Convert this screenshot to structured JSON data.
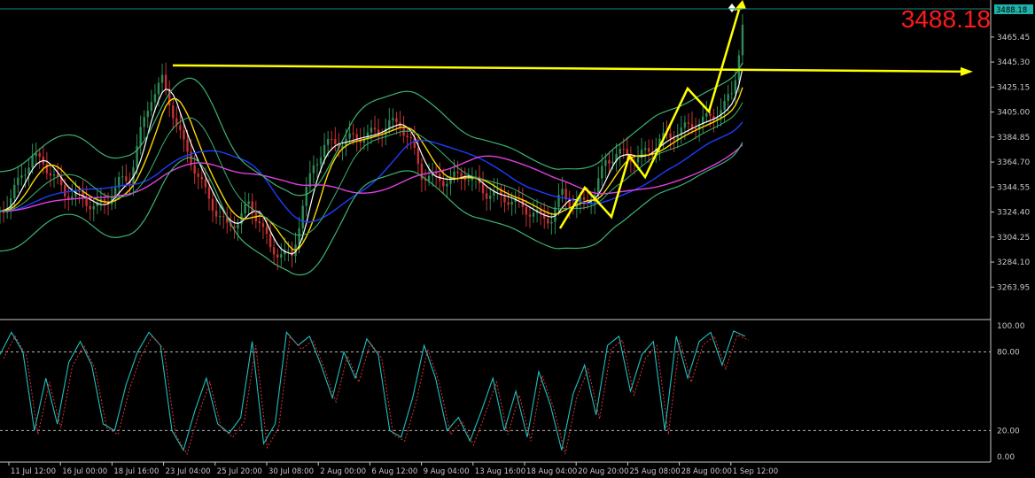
{
  "colors": {
    "background": "#000000",
    "axis": "#c8c8c8",
    "grid": "#b4b4b4",
    "bollinger": "#3cb371",
    "ma_fast": "#ffffff",
    "ma_slow": "#ffd700",
    "ma_blue": "#1e3cff",
    "ma_magenta": "#e040e0",
    "annotation": "#ffff00",
    "candle_up": "#2e8b57",
    "candle_down": "#c83232",
    "stoch_main": "#20c0c0",
    "stoch_signal": "#e03030",
    "price_label_bg": "#20b2aa",
    "big_price": "#ff1a1a"
  },
  "current_price_display": "3488.18",
  "price_label": "3488.18",
  "chart_data": [
    {
      "type": "line",
      "panel": "main",
      "y_ticks": [
        "3465.45",
        "3445.30",
        "3425.15",
        "3405.00",
        "3384.85",
        "3364.70",
        "3344.55",
        "3324.40",
        "3304.25",
        "3284.10",
        "3263.95"
      ],
      "y_tick_values": [
        3465.45,
        3445.3,
        3425.15,
        3405.0,
        3384.85,
        3364.7,
        3344.55,
        3324.4,
        3304.25,
        3284.1,
        3263.95
      ],
      "ylim": [
        3238.5,
        3488.18
      ],
      "x_ticks": [
        "11 Jul 12:00",
        "16 Jul 00:00",
        "18 Jul 16:00",
        "23 Jul 04:00",
        "25 Jul 20:00",
        "30 Jul 08:00",
        "2 Aug 00:00",
        "6 Aug 12:00",
        "9 Aug 04:00",
        "13 Aug 16:00",
        "18 Aug 04:00",
        "20 Aug 20:00",
        "25 Aug 08:00",
        "28 Aug 00:00",
        "1 Sep 12:00"
      ],
      "x_index": [
        0,
        7,
        14,
        21,
        28,
        35,
        42,
        49,
        56,
        63,
        70,
        77,
        84,
        91,
        98,
        105,
        112,
        119,
        126,
        133,
        140,
        147,
        154,
        161,
        168,
        175,
        182,
        189,
        196,
        203,
        210,
        217,
        224,
        231,
        238,
        245,
        252,
        259,
        266,
        273,
        280,
        287,
        294,
        301,
        308,
        315,
        322,
        329,
        336,
        343,
        350,
        357,
        364,
        371,
        378,
        385,
        392,
        399,
        406,
        413,
        420,
        427,
        434,
        441,
        448,
        455,
        462,
        469,
        476,
        483,
        490,
        497,
        504,
        511,
        518,
        525,
        532,
        539,
        546,
        553,
        560,
        567,
        574,
        581,
        588,
        595,
        602,
        609,
        616,
        623,
        630,
        637,
        644,
        651,
        658,
        665,
        672,
        679,
        686,
        693,
        700,
        707,
        714,
        721,
        728,
        735,
        742,
        749,
        756,
        763,
        770,
        777,
        784,
        791,
        798,
        805,
        812,
        819,
        826
      ],
      "close": [
        3325,
        3335,
        3355,
        3368,
        3365,
        3352,
        3340,
        3338,
        3333,
        3328,
        3335,
        3348,
        3352,
        3388,
        3418,
        3430,
        3405,
        3378,
        3360,
        3340,
        3325,
        3312,
        3318,
        3330,
        3318,
        3294,
        3292,
        3288,
        3330,
        3362,
        3378,
        3380,
        3382,
        3385,
        3386,
        3390,
        3395,
        3396,
        3380,
        3355,
        3352,
        3350,
        3352,
        3355,
        3348,
        3340,
        3338,
        3335,
        3330,
        3325,
        3320,
        3320,
        3340,
        3330,
        3332,
        3340,
        3365,
        3372,
        3370,
        3368,
        3374,
        3382,
        3386,
        3390,
        3395,
        3398,
        3402,
        3410,
        3420,
        3435,
        3455,
        3485
      ],
      "close_x_index": [
        0,
        12,
        24,
        36,
        48,
        60,
        72,
        84,
        96,
        108,
        120,
        132,
        144,
        156,
        168,
        180,
        192,
        204,
        216,
        228,
        240,
        252,
        264,
        276,
        288,
        300,
        312,
        324,
        336,
        348,
        360,
        372,
        384,
        396,
        408,
        420,
        432,
        444,
        456,
        468,
        480,
        492,
        504,
        516,
        528,
        540,
        552,
        564,
        576,
        588,
        600,
        612,
        624,
        636,
        648,
        660,
        672,
        684,
        696,
        708,
        720,
        732,
        744,
        756,
        768,
        780,
        792,
        804,
        812,
        816,
        820,
        826
      ],
      "series": [
        {
          "values_key": "close"
        },
        {
          "values_key": "close"
        },
        {
          "values_key": "close"
        },
        {
          "values_key": "close"
        },
        {
          "values_key": "close"
        }
      ],
      "horizontal_line_level": 3440.5
    },
    {
      "type": "line",
      "panel": "stochastic",
      "y_ticks": [
        "100.00",
        "80.00",
        "20.00",
        "0.00"
      ],
      "y_tick_values": [
        100,
        80,
        20,
        0
      ],
      "ylim": [
        0,
        100
      ],
      "levels": [
        80,
        20
      ],
      "main": [
        78,
        95,
        80,
        20,
        60,
        25,
        72,
        88,
        70,
        25,
        20,
        55,
        80,
        95,
        85,
        20,
        5,
        35,
        60,
        25,
        18,
        30,
        88,
        10,
        25,
        95,
        85,
        92,
        70,
        45,
        80,
        60,
        90,
        78,
        20,
        15,
        45,
        85,
        60,
        20,
        30,
        12,
        35,
        60,
        20,
        50,
        15,
        65,
        40,
        5,
        48,
        70,
        32,
        85,
        92,
        50,
        78,
        88,
        20,
        92,
        60,
        88,
        95,
        70,
        96,
        92
      ],
      "main_x": [
        0,
        12,
        24,
        36,
        48,
        60,
        72,
        84,
        96,
        108,
        120,
        132,
        144,
        156,
        168,
        180,
        192,
        204,
        216,
        228,
        240,
        252,
        264,
        276,
        288,
        300,
        312,
        324,
        336,
        348,
        360,
        372,
        384,
        396,
        408,
        420,
        432,
        444,
        456,
        468,
        480,
        492,
        504,
        516,
        528,
        540,
        552,
        564,
        576,
        588,
        600,
        612,
        624,
        636,
        648,
        660,
        672,
        684,
        696,
        708,
        720,
        732,
        744,
        756,
        768,
        780
      ]
    }
  ]
}
